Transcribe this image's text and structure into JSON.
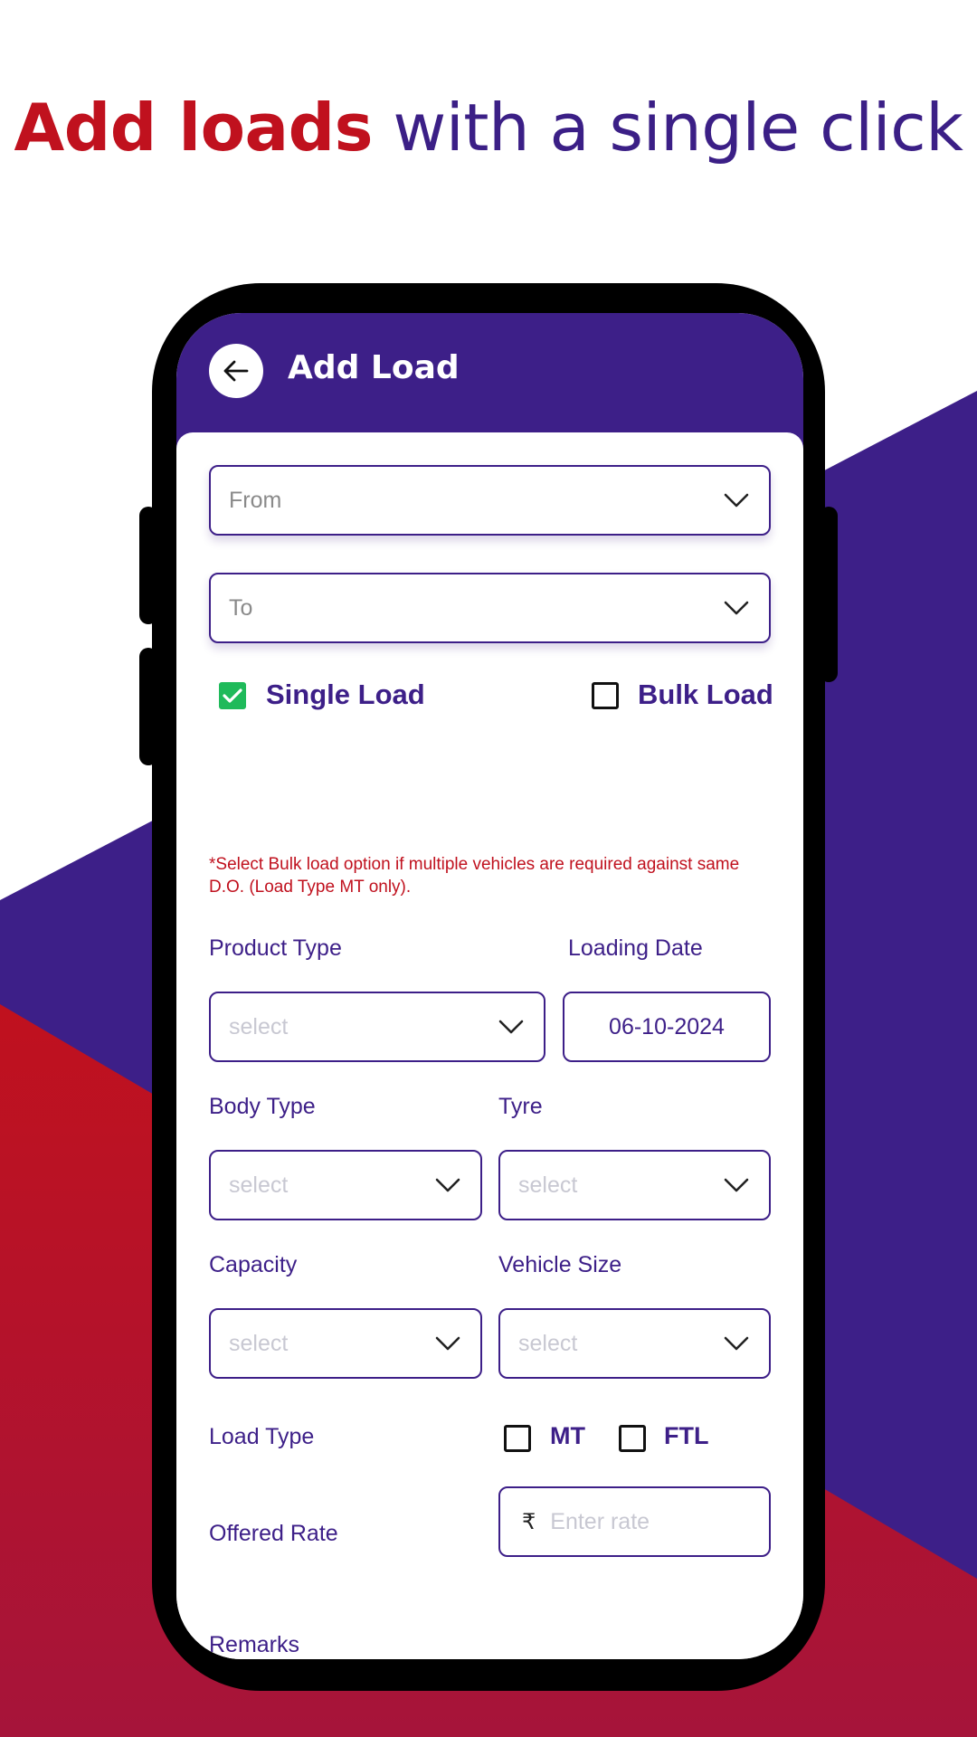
{
  "headline": {
    "accent": "Add loads",
    "rest": " with a single click"
  },
  "colors": {
    "brand_purple": "#3d1f88",
    "brand_red": "#c0111e",
    "check_green": "#1fba5a"
  },
  "appbar": {
    "title": "Add Load",
    "back_icon": "arrow-left-icon"
  },
  "route": {
    "from_placeholder": "From",
    "to_placeholder": "To"
  },
  "load_options": {
    "single": {
      "label": "Single Load",
      "checked": true
    },
    "bulk": {
      "label": "Bulk Load",
      "checked": false
    },
    "note": "*Select Bulk load option if multiple vehicles are required against same D.O. (Load Type MT only)."
  },
  "product_type": {
    "label": "Product Type",
    "placeholder": "select"
  },
  "loading_date": {
    "label": "Loading Date",
    "value": "06-10-2024"
  },
  "body_type": {
    "label": "Body Type",
    "placeholder": "select"
  },
  "tyre": {
    "label": "Tyre",
    "placeholder": "select"
  },
  "capacity": {
    "label": "Capacity",
    "placeholder": "select"
  },
  "vehicle_size": {
    "label": "Vehicle Size",
    "placeholder": "select"
  },
  "load_type": {
    "label": "Load Type",
    "options": [
      {
        "label": "MT",
        "checked": false
      },
      {
        "label": "FTL",
        "checked": false
      }
    ]
  },
  "offered_rate": {
    "label": "Offered Rate",
    "currency": "₹",
    "placeholder": "Enter rate"
  },
  "remarks": {
    "label": "Remarks"
  }
}
